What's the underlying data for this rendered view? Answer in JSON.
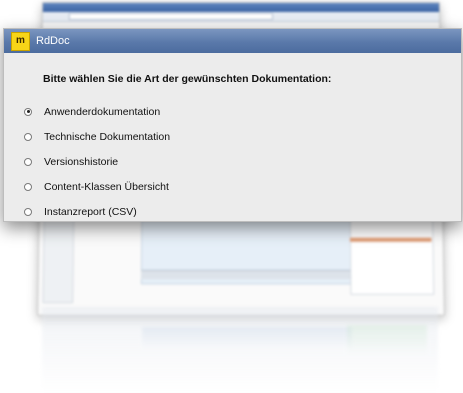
{
  "dialog": {
    "title": "RdDoc",
    "icon_letter": "m",
    "question": "Bitte wählen Sie die Art der gewünschten Dokumentation:",
    "options": [
      {
        "label": "Anwenderdokumentation",
        "selected": true
      },
      {
        "label": "Technische Dokumentation",
        "selected": false
      },
      {
        "label": "Versionshistorie",
        "selected": false
      },
      {
        "label": "Content-Klassen Übersicht",
        "selected": false
      },
      {
        "label": "Instanzreport (CSV)",
        "selected": false
      }
    ]
  },
  "colors": {
    "titlebar": "#5a79aa",
    "icon_bg": "#f7d518",
    "dialog_bg": "#ececec"
  }
}
